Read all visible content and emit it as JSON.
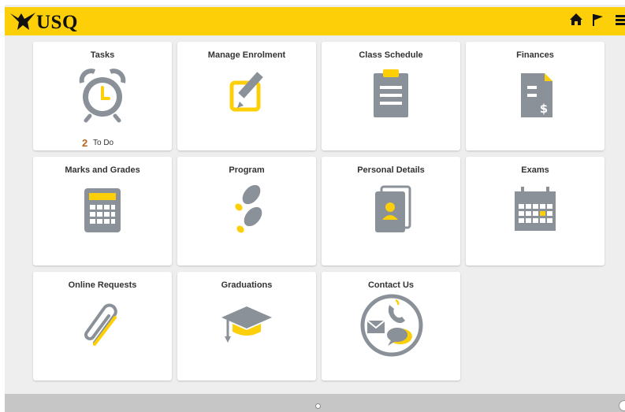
{
  "header": {
    "logo_text": "USQ",
    "icons": [
      "home-icon",
      "flag-icon",
      "menu-icon"
    ]
  },
  "tiles": [
    {
      "title": "Tasks",
      "icon": "alarm-clock-icon",
      "count": "2",
      "count_label": "To Do"
    },
    {
      "title": "Manage Enrolment",
      "icon": "edit-pencil-icon"
    },
    {
      "title": "Class Schedule",
      "icon": "clipboard-icon"
    },
    {
      "title": "Finances",
      "icon": "invoice-dollar-icon"
    },
    {
      "title": "Marks and Grades",
      "icon": "calculator-icon"
    },
    {
      "title": "Program",
      "icon": "footprints-icon"
    },
    {
      "title": "Personal Details",
      "icon": "contact-book-icon"
    },
    {
      "title": "Exams",
      "icon": "calendar-icon"
    },
    {
      "title": "Online Requests",
      "icon": "paperclip-icon"
    },
    {
      "title": "Graduations",
      "icon": "graduation-cap-icon"
    },
    {
      "title": "Contact Us",
      "icon": "contact-phone-mail-icon"
    }
  ],
  "colors": {
    "brand_yellow": "#fccf08",
    "icon_gray": "#8a9198",
    "count_orange": "#b5651d"
  }
}
